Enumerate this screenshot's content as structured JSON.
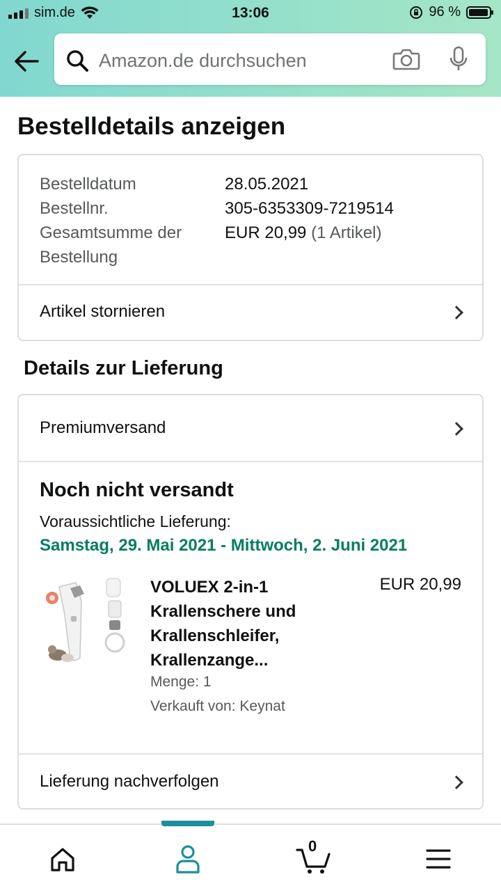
{
  "status_bar": {
    "carrier": "sim.de",
    "time": "13:06",
    "battery": "96 %",
    "battery_level": 0.96
  },
  "search": {
    "placeholder": "Amazon.de durchsuchen"
  },
  "page": {
    "title": "Bestelldetails anzeigen"
  },
  "order": {
    "date_label": "Bestelldatum",
    "date": "28.05.2021",
    "number_label": "Bestellnr.",
    "number": "305-6353309-7219514",
    "total_label": "Gesamtsumme der Bestellung",
    "total": "EUR 20,99",
    "items_count": "(1 Artikel)",
    "cancel_label": "Artikel stornieren"
  },
  "delivery": {
    "section_title": "Details zur Lieferung",
    "shipping_method": "Premiumversand",
    "status": "Noch nicht versandt",
    "expected_label": "Voraussichtliche Lieferung:",
    "expected_dates": "Samstag, 29. Mai 2021 - Mittwoch, 2. Juni 2021",
    "track_label": "Lieferung nachverfolgen"
  },
  "product": {
    "title": "VOLUEX 2-in-1 Krallenschere und Krallenschleifer, Krallenzange...",
    "price": "EUR 20,99",
    "quantity": "Menge: 1",
    "seller": "Verkauft von: Keynat"
  },
  "nav": {
    "cart_count": "0",
    "active_tab": "account"
  },
  "colors": {
    "header_gradient_start": "#81d8d0",
    "header_gradient_end": "#a5e6c6",
    "delivery_green": "#067d62",
    "nav_active": "#1b8f9a"
  }
}
